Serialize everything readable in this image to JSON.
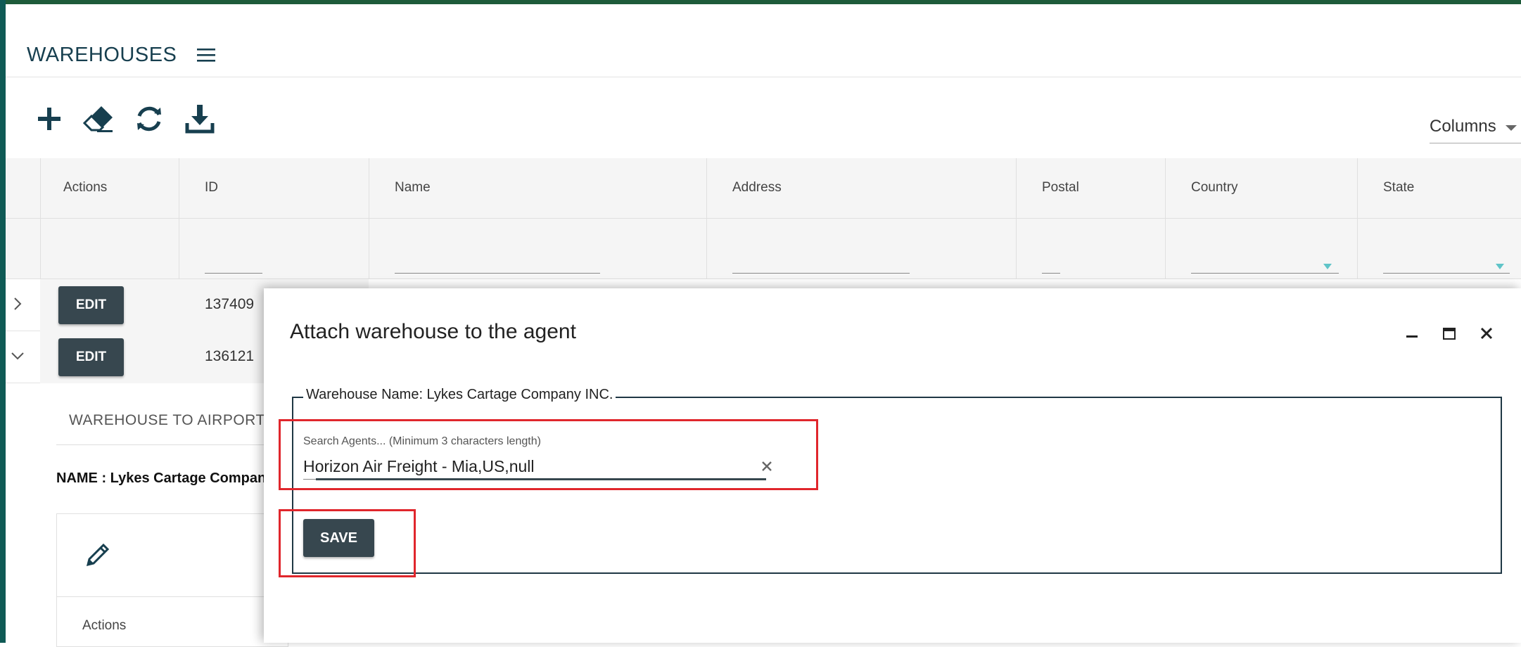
{
  "page": {
    "title": "WAREHOUSES"
  },
  "toolbar": {
    "icons": [
      "plus-icon",
      "eraser-icon",
      "refresh-icon",
      "download-icon"
    ],
    "columns_label": "Columns"
  },
  "grid": {
    "headers": [
      "Actions",
      "ID",
      "Name",
      "Address",
      "Postal",
      "Country",
      "State"
    ],
    "rows": [
      {
        "edit_label": "EDIT",
        "id": "137409",
        "expanded": false
      },
      {
        "edit_label": "EDIT",
        "id": "136121",
        "expanded": true
      }
    ]
  },
  "detail": {
    "tab_label": "WAREHOUSE TO AIRPORT",
    "name_text": "NAME : Lykes Cartage Company INC.",
    "sub_actions_header": "Actions"
  },
  "dialog": {
    "title": "Attach warehouse to the agent",
    "fieldset_legend": "Warehouse Name: Lykes Cartage Company INC.",
    "search_label": "Search Agents... (Minimum 3 characters length)",
    "search_value": "Horizon Air Freight - Mia,US,null",
    "save_label": "SAVE"
  },
  "colors": {
    "accent": "#173f4f",
    "button": "#37474f",
    "highlight": "#e0262c",
    "filter_caret": "#5fc4c8"
  }
}
